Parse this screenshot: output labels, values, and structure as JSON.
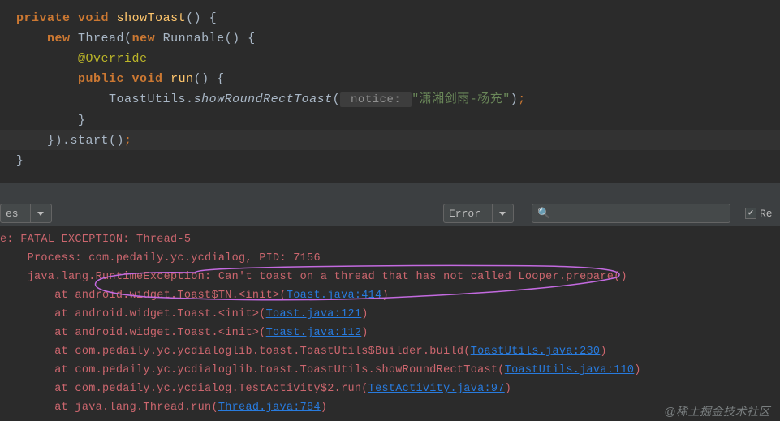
{
  "editor": {
    "l1": {
      "kw1": "private",
      "kw2": "void",
      "name": "showToast",
      "suffix": "() {"
    },
    "l2": {
      "kw1": "new",
      "cls": "Thread(",
      "kw2": "new",
      "run": "Runnable() {"
    },
    "l3": {
      "anno": "@Override"
    },
    "l4": {
      "kw1": "public",
      "kw2": "void",
      "name": "run",
      "suffix": "() {"
    },
    "l5": {
      "cls": "ToastUtils.",
      "call": "showRoundRectToast",
      "open": "(",
      "hint": " notice: ",
      "str": "\"潇湘剑雨-杨充\"",
      "close": ")",
      "semi": ";"
    },
    "l6": {
      "brace": "}"
    },
    "l7": {
      "close": "}).start()",
      "semi": ";"
    },
    "l8": {
      "brace": "}"
    }
  },
  "toolbar": {
    "dd1_label": "es",
    "dd2_label": "Error",
    "check_label": "Re",
    "check_state": "checked"
  },
  "log": {
    "l1_a": "e: ",
    "l1_b": "FATAL EXCEPTION: Thread-5",
    "l2": "    Process: com.pedaily.yc.ycdialog, PID: 7156",
    "l3": "    java.lang.RuntimeException: Can't toast on a thread that has not called Looper.prepare()",
    "l4_a": "        at android.widget.Toast$TN.<init>(",
    "l4_link": "Toast.java:414",
    "l4_b": ")",
    "l5_a": "        at android.widget.Toast.<init>(",
    "l5_link": "Toast.java:121",
    "l5_b": ")",
    "l6_a": "        at android.widget.Toast.<init>(",
    "l6_link": "Toast.java:112",
    "l6_b": ")",
    "l7_a": "        at com.pedaily.yc.ycdialoglib.toast.ToastUtils$Builder.build(",
    "l7_link": "ToastUtils.java:230",
    "l7_b": ")",
    "l8_a": "        at com.pedaily.yc.ycdialoglib.toast.ToastUtils.showRoundRectToast(",
    "l8_link": "ToastUtils.java:110",
    "l8_b": ")",
    "l9_a": "        at com.pedaily.yc.ycdialog.TestActivity$2.run(",
    "l9_link": "TestActivity.java:97",
    "l9_b": ")",
    "l10_a": "        at java.lang.Thread.run(",
    "l10_link": "Thread.java:784",
    "l10_b": ")"
  },
  "watermark": "@稀土掘金技术社区"
}
